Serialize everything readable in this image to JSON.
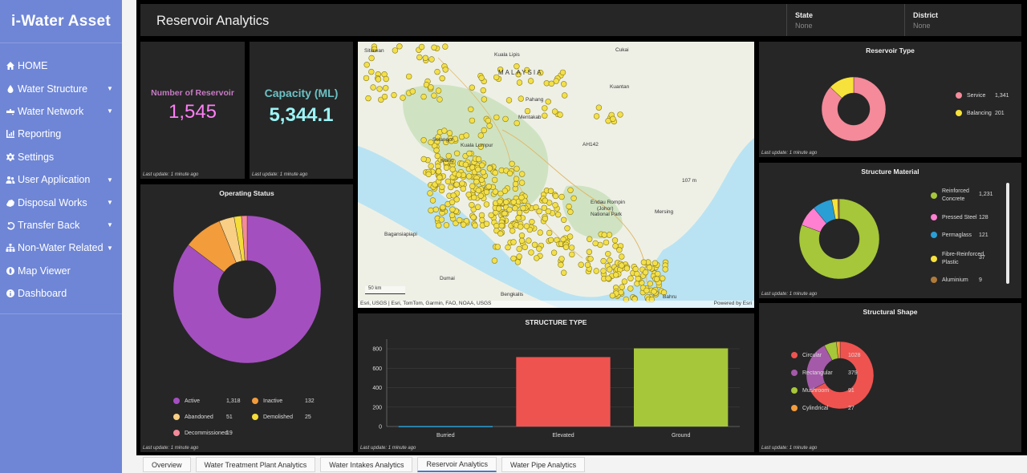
{
  "app": {
    "brand": "i-Water Asset"
  },
  "nav": [
    {
      "label": "HOME",
      "icon": "home-icon",
      "chevron": false
    },
    {
      "label": "Water Structure",
      "icon": "water-drop-icon",
      "chevron": true
    },
    {
      "label": "Water Network",
      "icon": "water-network-icon",
      "chevron": true
    },
    {
      "label": "Reporting",
      "icon": "report-icon",
      "chevron": false
    },
    {
      "label": "Settings",
      "icon": "gear-icon",
      "chevron": false
    },
    {
      "label": "User Application",
      "icon": "users-icon",
      "chevron": true
    },
    {
      "label": "Disposal Works",
      "icon": "disposal-icon",
      "chevron": true
    },
    {
      "label": "Transfer Back",
      "icon": "undo-icon",
      "chevron": true
    },
    {
      "label": "Non-Water Related",
      "icon": "sitemap-icon",
      "chevron": true
    },
    {
      "label": "Map Viewer",
      "icon": "globe-icon",
      "chevron": false
    },
    {
      "label": "Dashboard",
      "icon": "info-icon",
      "chevron": false
    }
  ],
  "header": {
    "title": "Reservoir Analytics",
    "state_label": "State",
    "state_value": "None",
    "district_label": "District",
    "district_value": "None"
  },
  "kpi": {
    "reservoir_label": "Number of Reservoir",
    "reservoir_value": "1,545",
    "capacity_label": "Capacity (ML)",
    "capacity_value": "5,344.1"
  },
  "last_update": "Last update: 1 minute ago",
  "colors": {
    "kpi_reservoir_label": "#c77bc4",
    "kpi_reservoir_value": "#ff7ff7",
    "kpi_capacity_label": "#6cc1c4",
    "kpi_capacity_value": "#9df4f6"
  },
  "map": {
    "places": [
      "Sitiawan",
      "Kuala Lipis",
      "Cukai",
      "MALAYSIA",
      "Kuantan",
      "Pahang",
      "Mentakab",
      "Selangor",
      "Kuala Lumpur",
      "Klang",
      "AH142",
      "Endau Rompin",
      "(Johor)",
      "National Park",
      "107 m",
      "Mersing",
      "Bagansiapiapi",
      "Dumai",
      "Bengkalis",
      "Bahru"
    ],
    "scale": "50 km",
    "attribution": "Esri, USGS | Esri, TomTom, Garmin, FAO, NOAA, USGS",
    "powered": "Powered by Esri"
  },
  "tabs": [
    "Overview",
    "Water Treatment Plant Analytics",
    "Water Intakes Analytics",
    "Reservoir Analytics",
    "Water Pipe Analytics"
  ],
  "active_tab": "Reservoir Analytics",
  "chart_data": [
    {
      "type": "pie",
      "title": "Operating Status",
      "labels": [
        "Active",
        "Inactive",
        "Abandoned",
        "Demolished",
        "Decommissioned"
      ],
      "values": [
        1318,
        132,
        51,
        25,
        19
      ],
      "value_labels": [
        "1,318",
        "132",
        "51",
        "25",
        "19"
      ],
      "colors": [
        "#a44fbf",
        "#f39c3c",
        "#f8cf84",
        "#f4dc3a",
        "#f48a9a"
      ],
      "legend": "bottom"
    },
    {
      "type": "bar",
      "title": "STRUCTURE TYPE",
      "categories": [
        "Burried",
        "Elevated",
        "Ground"
      ],
      "values": [
        5,
        715,
        805
      ],
      "colors": [
        "#2a9fd6",
        "#ef5350",
        "#a6c73a"
      ],
      "yticks": [
        0,
        200,
        400,
        600,
        800
      ],
      "ylim": [
        0,
        900
      ],
      "grid": true
    },
    {
      "type": "pie",
      "title": "Reservoir Type",
      "labels": [
        "Service",
        "Balancing"
      ],
      "values": [
        1341,
        201
      ],
      "value_labels": [
        "1,341",
        "201"
      ],
      "colors": [
        "#f48a9a",
        "#f6e23a"
      ],
      "legend": "right"
    },
    {
      "type": "pie",
      "title": "Structure Material",
      "labels": [
        "Reinforced Concrete",
        "Pressed Steel",
        "Permaglass",
        "Fibre-Reinforced Plastic",
        "Aluminium"
      ],
      "values": [
        1231,
        128,
        121,
        37,
        9
      ],
      "value_labels": [
        "1,231",
        "128",
        "121",
        "37",
        "9"
      ],
      "colors": [
        "#a6c73a",
        "#ff7fd0",
        "#2a9fd6",
        "#f6e23a",
        "#b07a3a"
      ],
      "legend": "right"
    },
    {
      "type": "pie",
      "title": "Structural Shape",
      "labels": [
        "Circular",
        "Rectangular",
        "Mushroom",
        "Cylindrical"
      ],
      "values": [
        1028,
        379,
        91,
        27
      ],
      "value_labels": [
        "1028",
        "379",
        "91",
        "27"
      ],
      "colors": [
        "#ef5350",
        "#a45aa8",
        "#a6c73a",
        "#f39c3c"
      ],
      "legend": "right"
    }
  ]
}
